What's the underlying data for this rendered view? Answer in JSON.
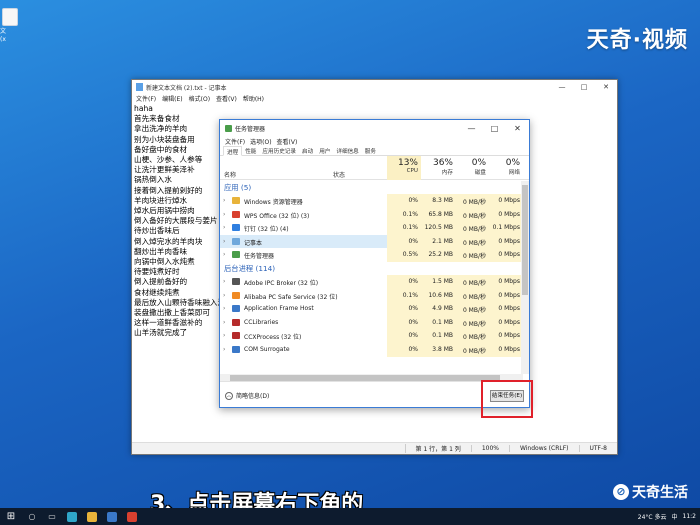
{
  "watermark": {
    "top": "天奇·视频",
    "bottom": "天奇生活",
    "logo": "⊘"
  },
  "desktop_icon": {
    "label": "文\n(x"
  },
  "notepad": {
    "title": "新建文本文档 (2).txt - 记事本",
    "menu": [
      "文件(F)",
      "编辑(E)",
      "格式(O)",
      "查看(V)",
      "帮助(H)"
    ],
    "text_lines": [
      "haha",
      "首先来备食材",
      "拿出洗净的羊肉",
      "别为小块装盘备用",
      "备好盘中的食材",
      "山梗、沙参、人参等",
      "让洗汁更鲜美泽补",
      "锅热倒入水",
      "接着倒入提前剁好的",
      "羊肉块进行焯水",
      "焯水后用锅中捞肉",
      "倒入备好的大展段与姜片",
      "待炒出香味后",
      "倒入焯完水的羊肉块",
      "翻炒出羊肉香味",
      "向锅中倒入水炖煮",
      "待要炖煮好时",
      "倒入提前备好的",
      "食材继续炖煮",
      "最后放入山颗待香味融入汤中",
      "装盘撒出撒上香菜即可",
      "这样一道鲜香滋补的",
      "山羊汤就完成了"
    ],
    "status": [
      "第 1 行，第 1 列",
      "100%",
      "Windows (CRLF)",
      "UTF-8"
    ]
  },
  "taskmgr": {
    "title": "任务管理器",
    "menu": [
      "文件(F)",
      "选项(O)",
      "查看(V)"
    ],
    "tabs": [
      "进程",
      "性能",
      "应用历史记录",
      "启动",
      "用户",
      "详细信息",
      "服务"
    ],
    "col_name": "名称",
    "col_status": "状态",
    "columns": [
      {
        "pct": "13%",
        "label": "CPU"
      },
      {
        "pct": "36%",
        "label": "内存"
      },
      {
        "pct": "0%",
        "label": "磁盘"
      },
      {
        "pct": "0%",
        "label": "网络"
      }
    ],
    "apps_header": "应用 (5)",
    "apps": [
      {
        "name": "Windows 资源管理器",
        "cpu": "0%",
        "mem": "8.3 MB",
        "disk": "0 MB/秒",
        "net": "0 Mbps",
        "color": "#e8b33a"
      },
      {
        "name": "WPS Office (32 位) (3)",
        "cpu": "0.1%",
        "mem": "65.8 MB",
        "disk": "0 MB/秒",
        "net": "0 Mbps",
        "color": "#d8402f"
      },
      {
        "name": "钉钉 (32 位) (4)",
        "cpu": "0.1%",
        "mem": "120.5 MB",
        "disk": "0 MB/秒",
        "net": "0.1 Mbps",
        "color": "#2f7fe0"
      },
      {
        "name": "记事本",
        "cpu": "0%",
        "mem": "2.1 MB",
        "disk": "0 MB/秒",
        "net": "0 Mbps",
        "color": "#6fa8dc",
        "selected": true
      },
      {
        "name": "任务管理器",
        "cpu": "0.5%",
        "mem": "25.2 MB",
        "disk": "0 MB/秒",
        "net": "0 Mbps",
        "color": "#4a9d4a"
      }
    ],
    "bg_header": "后台进程 (114)",
    "bg": [
      {
        "name": "Adobe IPC Broker (32 位)",
        "cpu": "0%",
        "mem": "1.5 MB",
        "disk": "0 MB/秒",
        "net": "0 Mbps",
        "color": "#555"
      },
      {
        "name": "Alibaba PC Safe Service (32 位)",
        "cpu": "0.1%",
        "mem": "10.6 MB",
        "disk": "0 MB/秒",
        "net": "0 Mbps",
        "color": "#f08a24"
      },
      {
        "name": "Application Frame Host",
        "cpu": "0%",
        "mem": "4.9 MB",
        "disk": "0 MB/秒",
        "net": "0 Mbps",
        "color": "#3a78c8"
      },
      {
        "name": "CCLibraries",
        "cpu": "0%",
        "mem": "0.1 MB",
        "disk": "0 MB/秒",
        "net": "0 Mbps",
        "color": "#b52b2b"
      },
      {
        "name": "CCXProcess (32 位)",
        "cpu": "0%",
        "mem": "0.1 MB",
        "disk": "0 MB/秒",
        "net": "0 Mbps",
        "color": "#b52b2b"
      },
      {
        "name": "COM Surrogate",
        "cpu": "0%",
        "mem": "3.8 MB",
        "disk": "0 MB/秒",
        "net": "0 Mbps",
        "color": "#3a78c8"
      }
    ],
    "fewer_details": "简略信息(D)",
    "end_task": "结束任务(E)"
  },
  "caption": "3、点击屏幕右下角的",
  "taskbar": {
    "weather": "24°C 多云",
    "time": "11:2",
    "lang": "中"
  }
}
